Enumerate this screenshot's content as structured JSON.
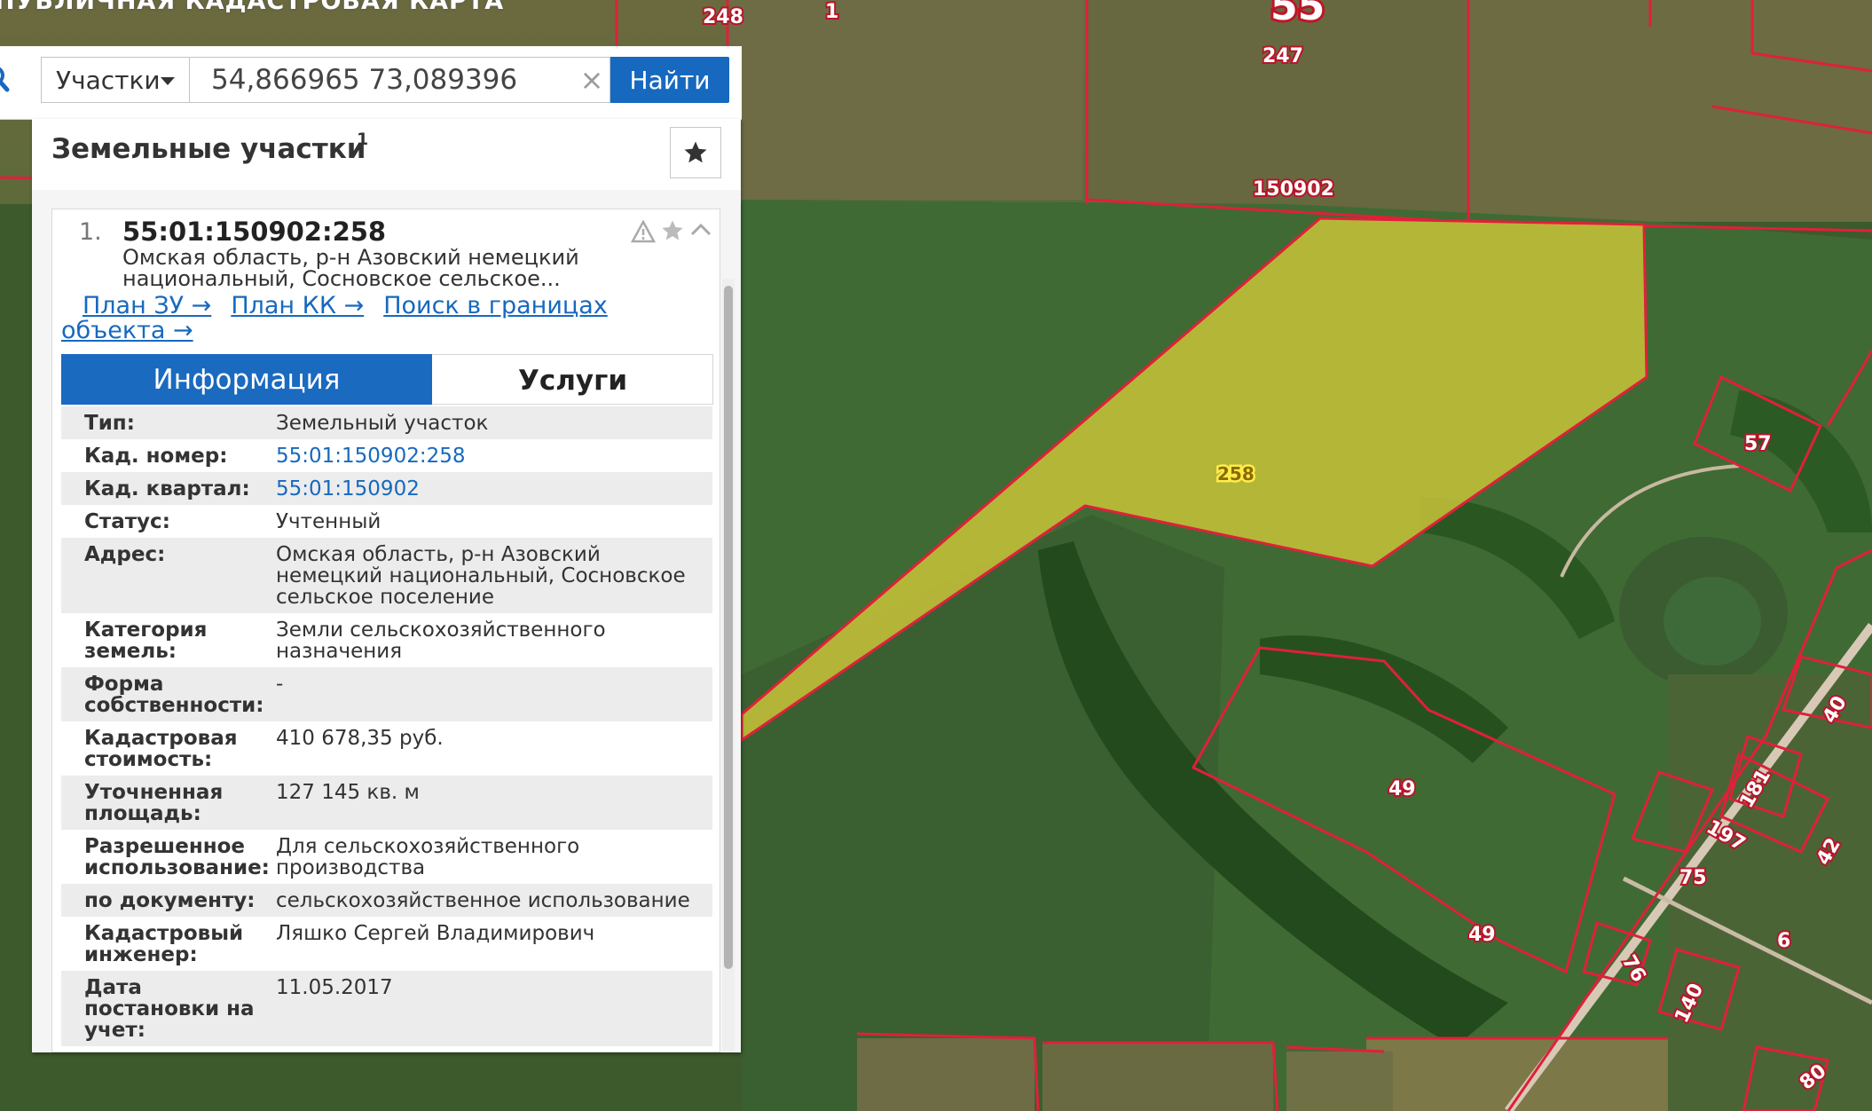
{
  "app": {
    "title": "ПУБЛИЧНАЯ КАДАСТРОВАЯ КАРТА"
  },
  "search": {
    "type_label": "Участки",
    "query": "54,866965 73,089396",
    "clear_symbol": "×",
    "find_label": "Найти"
  },
  "panel": {
    "title": "Земельные участки",
    "count": "1"
  },
  "result": {
    "number": "1.",
    "cadnum": "55:01:150902:258",
    "address_line1": "Омская область, р-н Азовский немецкий",
    "address_line2": "национальный, Сосновское сельское...",
    "links": {
      "plan_zu": "План ЗУ →",
      "plan_kk": "План КК →",
      "search_in_bounds": "Поиск в границах",
      "search_in_bounds_2": "объекта →"
    },
    "tabs": {
      "info": "Информация",
      "services": "Услуги"
    },
    "info_rows": [
      {
        "label": "Тип:",
        "value": "Земельный участок"
      },
      {
        "label": "Кад. номер:",
        "value": "55:01:150902:258"
      },
      {
        "label": "Кад. квартал:",
        "value": "55:01:150902"
      },
      {
        "label": "Статус:",
        "value": "Учтенный"
      },
      {
        "label": "Адрес:",
        "value": "Омская область, р-н Азовский немецкий национальный, Сосновское сельское поселение"
      },
      {
        "label": "Категория земель:",
        "value": "Земли сельскохозяйственного назначения"
      },
      {
        "label": "Форма собственности:",
        "value": "-"
      },
      {
        "label": "Кадастровая стоимость:",
        "value": "410 678,35 руб."
      },
      {
        "label": "Уточненная площадь:",
        "value": "127 145 кв. м"
      },
      {
        "label": "Разрешенное использование:",
        "value": "Для сельскохозяйственного производства"
      },
      {
        "label": "по документу:",
        "value": "сельскохозяйственное использование"
      },
      {
        "label": "Кадастровый инженер:",
        "value": "Ляшко Сергей Владимирович"
      },
      {
        "label": "Дата постановки на учет:",
        "value": "11.05.2017"
      }
    ]
  },
  "map": {
    "labels": {
      "l248": "248",
      "l1": "1",
      "l55": "55",
      "l247": "247",
      "l150902": "150902",
      "l258": "258",
      "l57": "57",
      "l49a": "49",
      "l49b": "49",
      "l40": "40",
      "l181": "181",
      "l197": "197",
      "l42": "42",
      "l75": "75",
      "l76": "76",
      "l6": "6",
      "l140": "140",
      "l80": "80"
    },
    "colors": {
      "selected_parcel": "#c9c33a",
      "parcel_border": "#e0203a",
      "accent": "#1769bf"
    }
  }
}
